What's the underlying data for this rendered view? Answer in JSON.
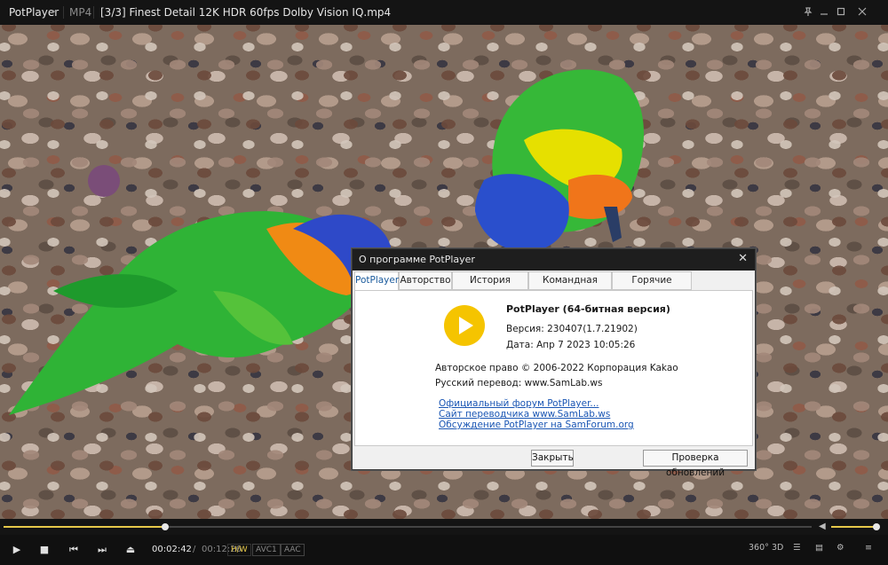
{
  "titlebar": {
    "app_name": "PotPlayer",
    "format": "MP4",
    "file_title": "[3/3] Finest Detail 12K HDR 60fps   Dolby Vision IQ.mp4",
    "icons": [
      "chevron-down-icon",
      "pin-icon",
      "minimize-icon",
      "maximize-icon",
      "close-icon"
    ]
  },
  "dialog": {
    "title": "О программе PotPlayer",
    "tabs": [
      "PotPlayer",
      "Авторство",
      "История версий",
      "Командная строка",
      "Горячие клавиши"
    ],
    "active_tab": "PotPlayer",
    "product": "PotPlayer (64-битная версия)",
    "version": "Версия: 230407(1.7.21902)",
    "date": "Дата: Апр  7 2023 10:05:26",
    "copyright": "Авторское право © 2006-2022 Корпорация Kakao",
    "translation": "Русский перевод: www.SamLab.ws",
    "links": [
      "Официальный форум PotPlayer...",
      "Сайт переводчика www.SamLab.ws",
      "Обсуждение PotPlayer на SamForum.org"
    ],
    "close_button": "Закрыть",
    "update_button": "Проверка обновлений",
    "logo_color": "#f5c400"
  },
  "playback": {
    "progress_fraction": 0.2,
    "volume_fraction": 0.98,
    "current_time": "00:02:42",
    "separator": "/",
    "total_time": "00:12:26",
    "hw_badge": "H/W",
    "video_codec": "AVC1",
    "audio_codec": "AAC",
    "accent_color": "#e6c84a",
    "right_labels": {
      "vr": "360°",
      "three_d": "3D"
    }
  }
}
